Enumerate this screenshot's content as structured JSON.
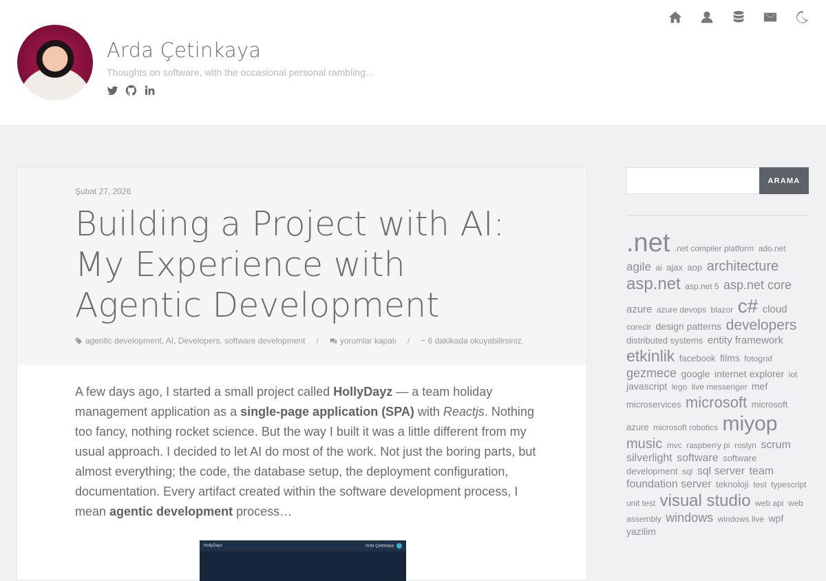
{
  "header": {
    "site_title": "Arda Çetinkaya",
    "tagline": "Thoughts on software, with the occasional personal rambling..."
  },
  "nav": {
    "icons": [
      "home-icon",
      "user-icon",
      "database-icon",
      "mail-icon",
      "moon-icon"
    ]
  },
  "social": {
    "icons": [
      "twitter-icon",
      "github-icon",
      "linkedin-icon"
    ]
  },
  "post": {
    "date": "Şubat 27, 2026",
    "title": "Building a Project with AI: My Experience with Agentic Development",
    "tags": "agentic development, AI, Developers, software development",
    "comments": "yorumlar kapalı",
    "reading_time": "~ 6 dakikada okuyabilirsiniz.",
    "body": {
      "p1": "A few days ago, I started a small project called ",
      "b1": "HollyDayz",
      "p2": " — a team holiday management application as a ",
      "b2": "single-page application (SPA)",
      "p3": " with ",
      "i1": "Reactjs",
      "p4": ". Nothing too fancy, nothing rocket science. But the way I built it was a little different from my usual approach. I decided to let AI do most of the work. Not just the boring parts, but almost everything; the code, the database setup, the deployment configuration, documentation. Every artifact created within the software development process, I mean ",
      "b3": "agentic development",
      "p5": " process…"
    },
    "image": {
      "app_name": "HollyDayz",
      "user_name": "Arda Çetinkaya"
    }
  },
  "sidebar": {
    "search_placeholder": "",
    "search_button": "ARAMA",
    "tags": [
      {
        "t": ".net",
        "s": 38
      },
      {
        "t": ".net compiler platform",
        "s": 12
      },
      {
        "t": "ado.net",
        "s": 12
      },
      {
        "t": "agile",
        "s": 17
      },
      {
        "t": "ai",
        "s": 12
      },
      {
        "t": "ajax",
        "s": 13
      },
      {
        "t": "aop",
        "s": 13
      },
      {
        "t": "architecture",
        "s": 20
      },
      {
        "t": "asp.net",
        "s": 24
      },
      {
        "t": "asp.net 5",
        "s": 12
      },
      {
        "t": "asp.net core",
        "s": 18
      },
      {
        "t": "azure",
        "s": 15
      },
      {
        "t": "azure devops",
        "s": 12
      },
      {
        "t": "blazor",
        "s": 12
      },
      {
        "t": "c#",
        "s": 28
      },
      {
        "t": "cloud",
        "s": 15
      },
      {
        "t": "coreclr",
        "s": 12
      },
      {
        "t": "design patterns",
        "s": 14
      },
      {
        "t": "developers",
        "s": 21
      },
      {
        "t": "distributed systems",
        "s": 13
      },
      {
        "t": "entity framework",
        "s": 15
      },
      {
        "t": "etkinlik",
        "s": 23
      },
      {
        "t": "facebook",
        "s": 13
      },
      {
        "t": "films",
        "s": 14
      },
      {
        "t": "fotograf",
        "s": 12
      },
      {
        "t": "gezmece",
        "s": 18
      },
      {
        "t": "google",
        "s": 14
      },
      {
        "t": "internet explorer",
        "s": 14
      },
      {
        "t": "iot",
        "s": 12
      },
      {
        "t": "javascript",
        "s": 14
      },
      {
        "t": "lego",
        "s": 12
      },
      {
        "t": "live messenger",
        "s": 12
      },
      {
        "t": "mef",
        "s": 14
      },
      {
        "t": "microservices",
        "s": 13
      },
      {
        "t": "microsoft",
        "s": 22
      },
      {
        "t": "microsoft azure",
        "s": 13
      },
      {
        "t": "microsoft robotics",
        "s": 12
      },
      {
        "t": "miyop",
        "s": 30
      },
      {
        "t": "music",
        "s": 20
      },
      {
        "t": "mvc",
        "s": 12
      },
      {
        "t": "raspberry pi",
        "s": 12
      },
      {
        "t": "roslyn",
        "s": 12
      },
      {
        "t": "scrum",
        "s": 16
      },
      {
        "t": "silverlight",
        "s": 16
      },
      {
        "t": "software",
        "s": 16
      },
      {
        "t": "software development",
        "s": 13
      },
      {
        "t": "sql",
        "s": 12
      },
      {
        "t": "sql server",
        "s": 16
      },
      {
        "t": "team foundation server",
        "s": 16
      },
      {
        "t": "teknoloji",
        "s": 13
      },
      {
        "t": "test",
        "s": 12
      },
      {
        "t": "typescript",
        "s": 12
      },
      {
        "t": "unit test",
        "s": 12
      },
      {
        "t": "visual studio",
        "s": 24
      },
      {
        "t": "web api",
        "s": 12
      },
      {
        "t": "web assembly",
        "s": 12
      },
      {
        "t": "windows",
        "s": 18
      },
      {
        "t": "windows live",
        "s": 12
      },
      {
        "t": "wpf",
        "s": 14
      },
      {
        "t": "yazilim",
        "s": 14
      }
    ]
  }
}
